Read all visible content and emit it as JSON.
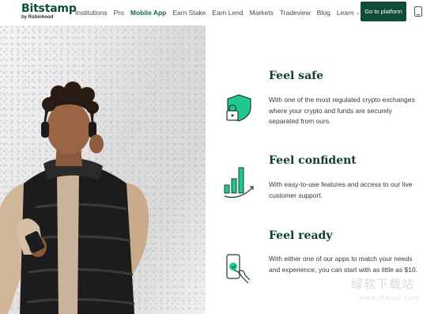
{
  "header": {
    "logo": "Bitstamp",
    "logo_sub": "by Robinhood",
    "nav": [
      {
        "label": "Institutions"
      },
      {
        "label": "Pro"
      },
      {
        "label": "Mobile App"
      },
      {
        "label": "Earn Stake"
      },
      {
        "label": "Earn Lend"
      },
      {
        "label": "Markets"
      },
      {
        "label": "Tradeview"
      },
      {
        "label": "Blog"
      },
      {
        "label": "Learn"
      }
    ],
    "active_nav": "Mobile App",
    "cta": "Go to platform",
    "device_icon": "mobile-phone-icon"
  },
  "features": [
    {
      "title": "Feel safe",
      "text": "With one of the most regulated crypto exchanges where your crypto and funds are securely separated from ours.",
      "icon": "shield-lock-icon"
    },
    {
      "title": "Feel confident",
      "text": "With easy-to-use features and access to our live customer support.",
      "icon": "bar-chart-growth-icon"
    },
    {
      "title": "Feel ready",
      "text": "With either one of our apps to match your needs and experience, you can start with as little as $10.",
      "icon": "hand-phone-icon"
    }
  ],
  "watermark": {
    "text": "绿软下载站",
    "url": "www.itmop.com"
  },
  "colors": {
    "brand": "#0f4d3a",
    "accent": "#1fc98e",
    "text": "#2d3f39"
  }
}
